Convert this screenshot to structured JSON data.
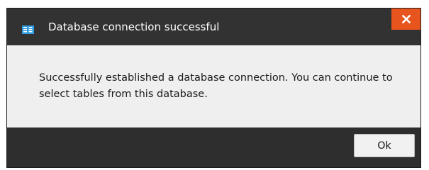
{
  "dialog": {
    "title": "Database connection successful",
    "title_icon": "database-connection-icon",
    "close_icon": "close-icon",
    "message": "Successfully established a database connection. You can continue to select tables from this database.",
    "ok_label": "Ok"
  },
  "colors": {
    "titlebar_bg": "#323232",
    "content_bg": "#efefef",
    "footer_bg": "#2e2e2e",
    "close_bg": "#e8541e",
    "icon_blue": "#2f9be0"
  }
}
